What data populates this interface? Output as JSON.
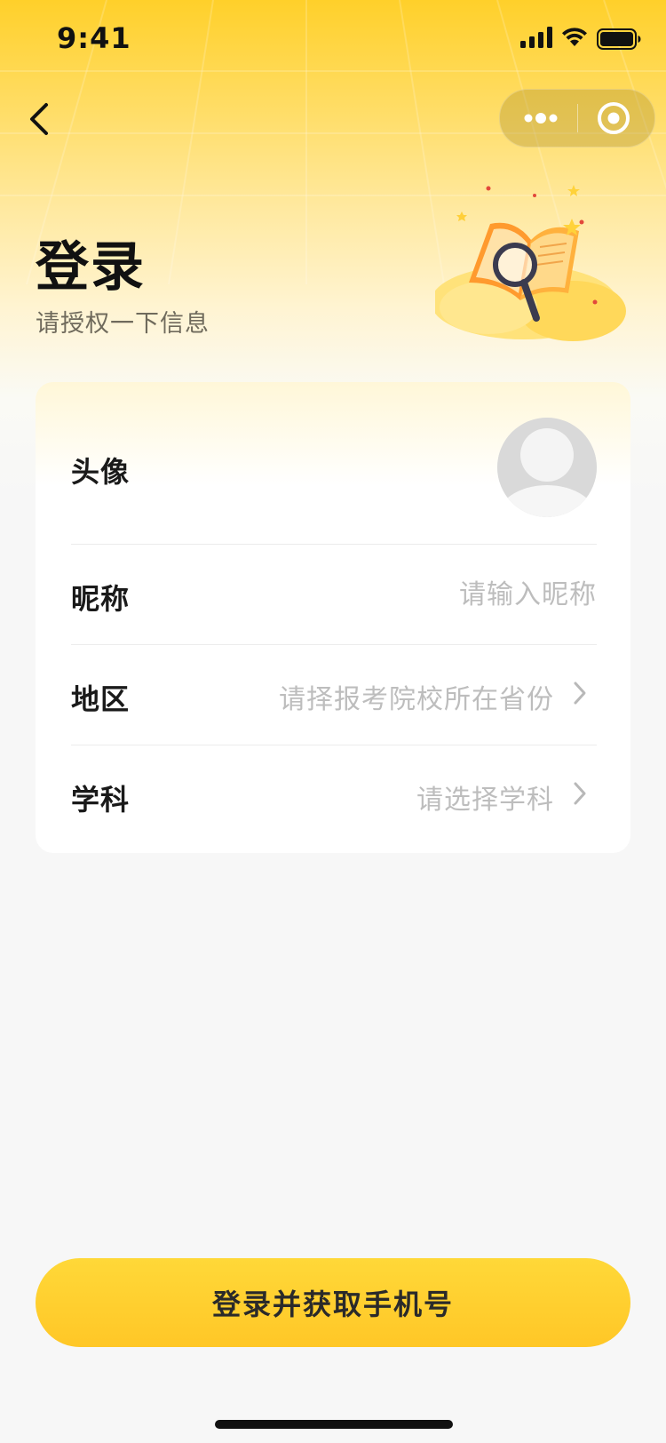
{
  "status_bar": {
    "time": "9:41"
  },
  "header": {
    "title": "登录",
    "subtitle": "请授权一下信息"
  },
  "form": {
    "avatar": {
      "label": "头像"
    },
    "nickname": {
      "label": "昵称",
      "placeholder": "请输入昵称"
    },
    "region": {
      "label": "地区",
      "placeholder": "请择报考院校所在省份"
    },
    "subject": {
      "label": "学科",
      "placeholder": "请选择学科"
    }
  },
  "actions": {
    "login_label": "登录并获取手机号"
  },
  "colors": {
    "accent": "#ffc727",
    "header_top": "#ffd02a",
    "placeholder": "#bdbdbd"
  },
  "icons": [
    "back-arrow-icon",
    "more-dots-icon",
    "close-capsule-icon",
    "chevron-right-icon",
    "signal-icon",
    "wifi-icon",
    "battery-icon"
  ]
}
